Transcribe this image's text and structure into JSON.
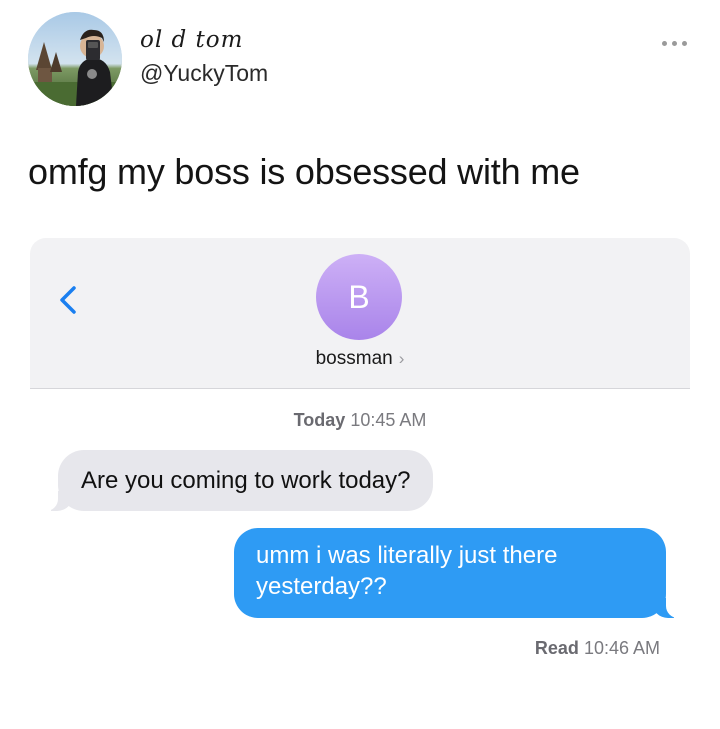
{
  "tweet": {
    "display_name": "ol d tom",
    "handle": "@YuckyTom",
    "text": "omfg my boss is obsessed with me",
    "more_icon": "more-dots-icon"
  },
  "imessage": {
    "back_icon": "chevron-left-icon",
    "contact": {
      "initial": "B",
      "name": "bossman",
      "chevron": "›",
      "avatar_color": "#b896f1"
    },
    "timestamp": {
      "day": "Today",
      "time": "10:45 AM"
    },
    "messages": [
      {
        "direction": "incoming",
        "text": "Are you coming to work today?"
      },
      {
        "direction": "outgoing",
        "text": "umm i was literally just there yesterday??"
      }
    ],
    "receipt": {
      "label": "Read",
      "time": "10:46 AM"
    },
    "colors": {
      "outgoing_bubble": "#2e9bf4",
      "incoming_bubble": "#e7e7ec",
      "accent": "#1a7ff0"
    }
  }
}
